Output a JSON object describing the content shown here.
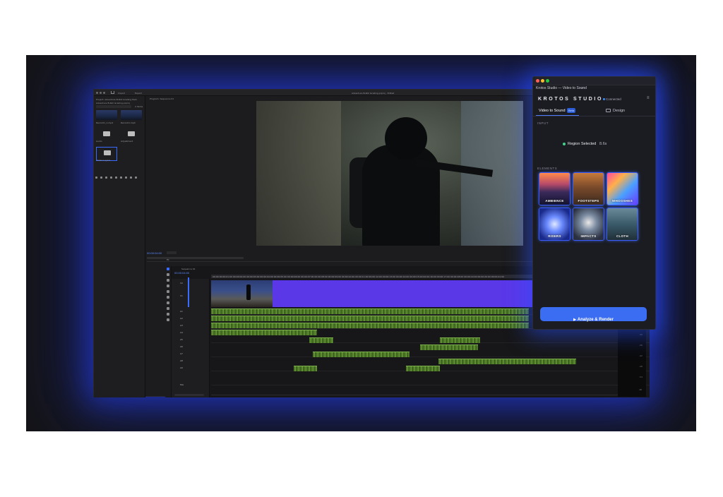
{
  "editor": {
    "menu": {
      "import": "Import",
      "export": "Export"
    },
    "sequence_title": "Adventure B-Roll Grading.prproj - Edited",
    "project_panel": {
      "name": "Project: Adventure B-Roll Grading Pack",
      "path": "Adventure B-Roll Grading.prproj",
      "item_count": "4 items",
      "bins": [
        {
          "label": "Recon01_1.mp4",
          "kind": "clip"
        },
        {
          "label": "Recon01.mp4",
          "kind": "clip"
        },
        {
          "label": "Audio",
          "kind": "folder"
        },
        {
          "label": "Adjustment",
          "kind": "folder"
        },
        {
          "label": "Video Layers",
          "kind": "folder"
        }
      ]
    },
    "program": {
      "title": "Program: Sequence 01",
      "timecode": "00:00:04:00",
      "fit": "Fit"
    },
    "timeline": {
      "tab": "Sequence 01",
      "timecode": "00:00:04:00",
      "ruler": "00:00  00:00:01:00  00:00:02:00  00:00:03:00  00:00:04:00  00:00:05:00  00:00:06:00  00:00:07:00  00:00:08:00  00:00:09:00  00:00:10:00  00:00:11:00  00:00:12:00  00:00:13:00  00:00:14:00  00:00:15:00  00:00:16:00  00:00:17:00  00:00:18:00  00:00:19:00  00:00:20:00  00:00:21:00",
      "tracks": [
        "V2",
        "V1",
        "A1",
        "A2",
        "A3",
        "A4",
        "A5",
        "A6",
        "A7",
        "A8",
        "A9",
        "Mix"
      ]
    },
    "meter_ticks": [
      "0",
      "-6",
      "-12",
      "-18",
      "-24",
      "-30",
      "-36",
      "-42",
      "-48",
      "-54",
      "dB"
    ]
  },
  "krotos": {
    "window_title": "Krotos Studio — Video to Sound",
    "close_glyph": "✕",
    "logo": "KROTOS STUDIO",
    "connected": "Connected",
    "menu_glyph": "≡",
    "tabs": {
      "video_to_sound": "Video to Sound",
      "beta": "Beta",
      "design": "Design"
    },
    "input_label": "INPUT",
    "region_selected": "Region Selected",
    "region_duration": "8.6s",
    "elements_label": "ELEMENTS",
    "elements": [
      "AMBIENCE",
      "FOOTSTEPS",
      "WHOOSHES",
      "RISERS",
      "IMPACTS",
      "CLOTH"
    ],
    "render_button": "Analyze & Render",
    "render_icon": "▶",
    "accent_color": "#3b6df2",
    "status_color": "#3fd48a"
  }
}
